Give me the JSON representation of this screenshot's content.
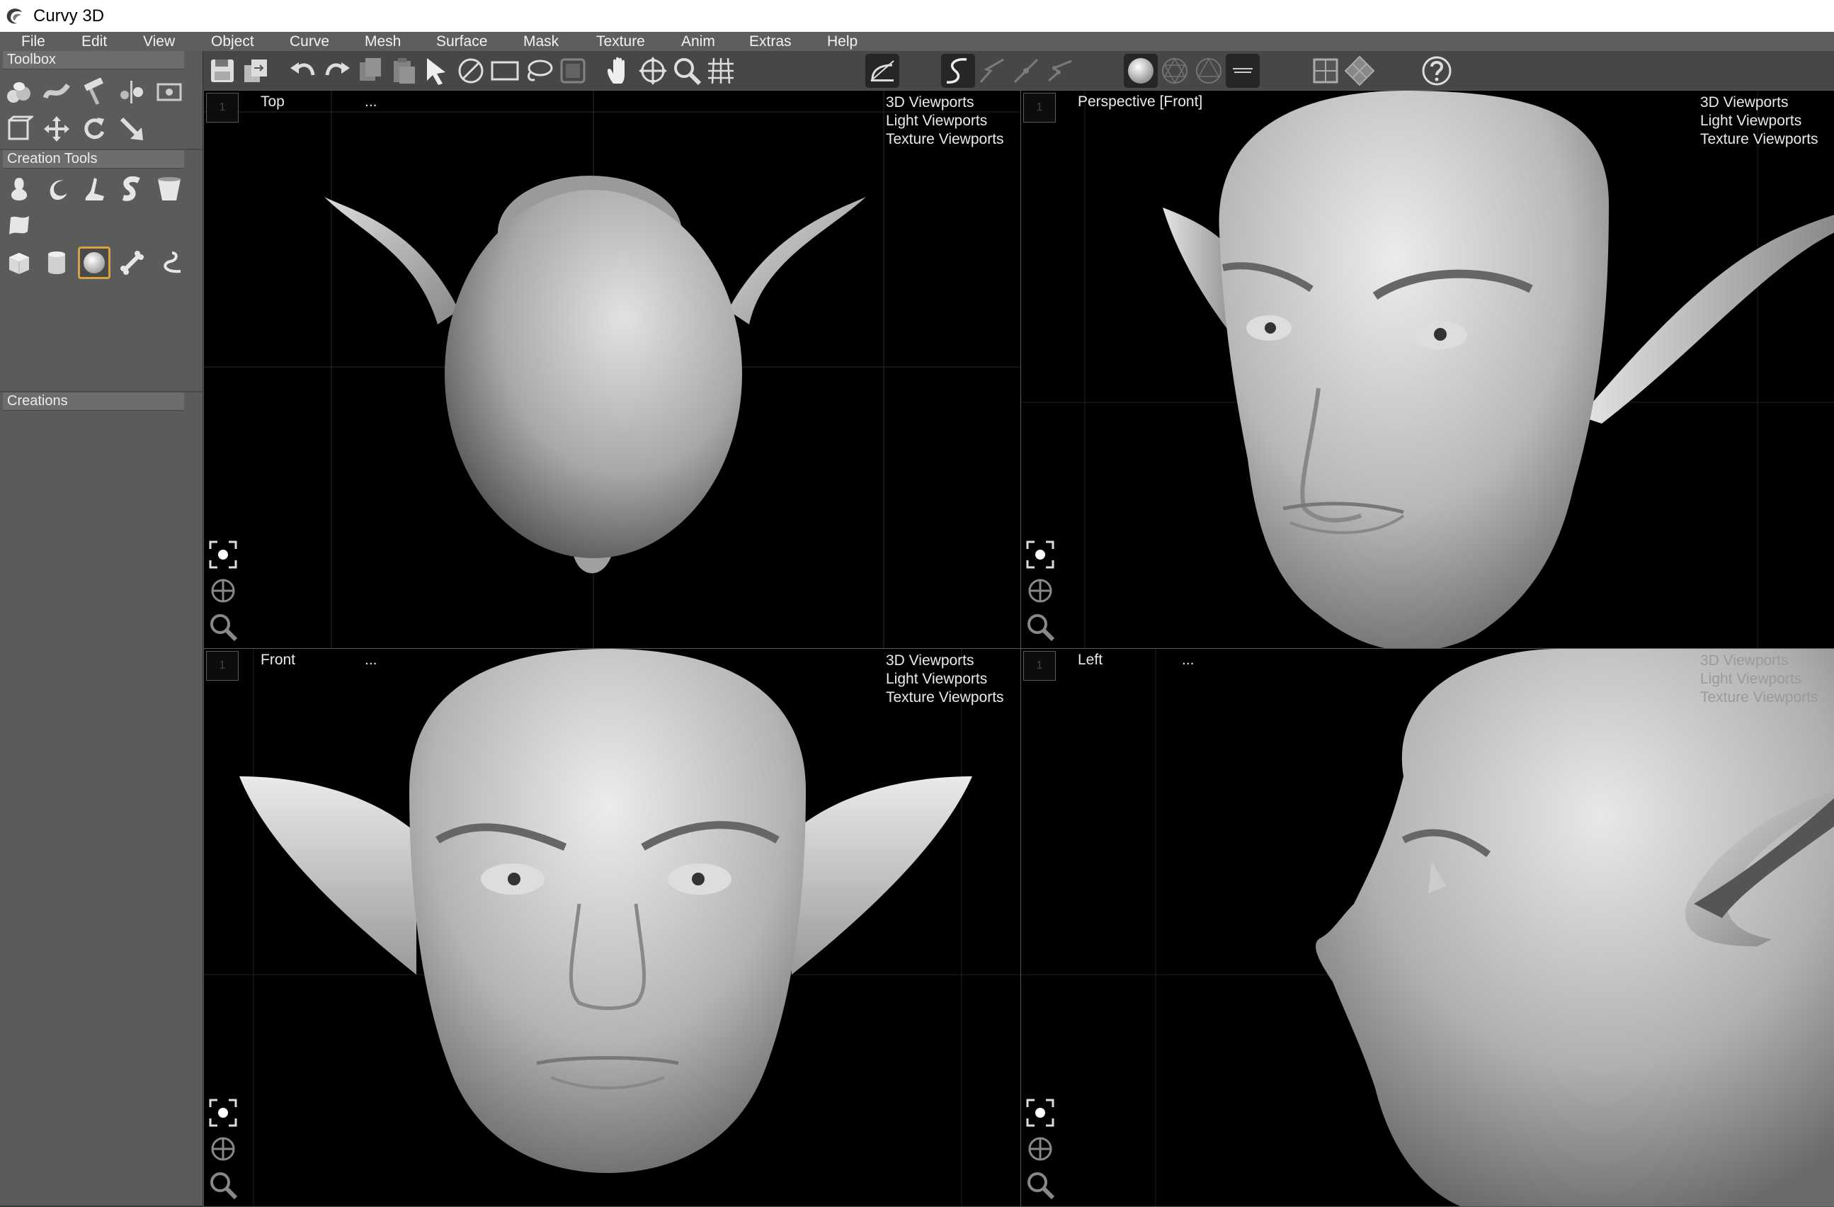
{
  "app": {
    "title": "Curvy 3D",
    "logo_icon": "curvy-logo-icon"
  },
  "menu": [
    "File",
    "Edit",
    "View",
    "Object",
    "Curve",
    "Mesh",
    "Surface",
    "Mask",
    "Texture",
    "Anim",
    "Extras",
    "Help"
  ],
  "left_panel": {
    "toolbox_label": "Toolbox",
    "creation_tools_label": "Creation Tools",
    "creations_label": "Creations",
    "selected_tool": "sphere-tool",
    "selected_color": "#d6a340"
  },
  "toolbar": {
    "icons": [
      "save-icon",
      "export-icon",
      "undo-icon",
      "redo-icon",
      "copy-icon",
      "paste-icon",
      "select-arrow-icon",
      "deselect-icon",
      "rectangle-select-icon",
      "lasso-select-icon",
      "mask-select-icon",
      "pan-hand-icon",
      "move-view-icon",
      "zoom-icon",
      "grid-icon",
      "curve-edit-icon",
      "curve-tool-icon",
      "curve-tool-2-icon",
      "curve-tool-3-icon",
      "curve-tool-4-icon",
      "shaded-sphere-icon",
      "wire-sphere-icon",
      "wire-sphere-2-icon",
      "curved-mode-icon",
      "single-view-icon",
      "quad-view-icon",
      "help-icon"
    ]
  },
  "viewports": [
    {
      "name": "Top",
      "dots": "...",
      "menu": [
        "3D Viewports",
        "Light Viewports",
        "Texture Viewports"
      ]
    },
    {
      "name": "Perspective [Front]",
      "dots": "",
      "menu": [
        "3D Viewports",
        "Light Viewports",
        "Texture Viewports"
      ]
    },
    {
      "name": "Front",
      "dots": "...",
      "menu": [
        "3D Viewports",
        "Light Viewports",
        "Texture Viewports"
      ]
    },
    {
      "name": "Left",
      "dots": "...",
      "menu": [
        "3D Viewports",
        "Light Viewports",
        "Texture Viewports"
      ]
    }
  ],
  "viewport_number": "1",
  "viewport_menu_ellipsis": "...",
  "colors": {
    "viewport_bg": "#000000",
    "model": "#bcbcbc",
    "panel": "#5b5b5b"
  }
}
